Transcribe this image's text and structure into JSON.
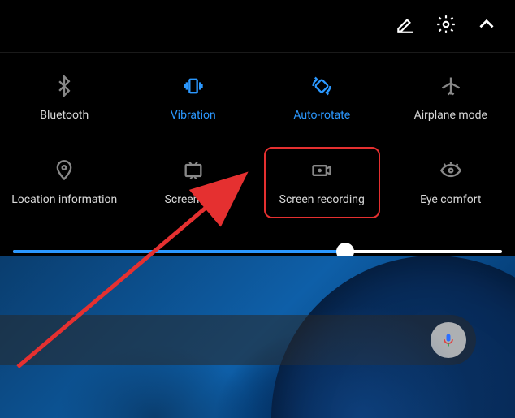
{
  "topbar": {
    "edit_icon": "edit-icon",
    "settings_icon": "gear-icon",
    "collapse_icon": "chevron-up-icon"
  },
  "tiles": [
    {
      "id": "bluetooth",
      "label": "Bluetooth",
      "active": false
    },
    {
      "id": "vibration",
      "label": "Vibration",
      "active": true
    },
    {
      "id": "autorotate",
      "label": "Auto-rotate",
      "active": true
    },
    {
      "id": "airplane",
      "label": "Airplane mode",
      "active": false
    },
    {
      "id": "location",
      "label": "Location information",
      "active": false
    },
    {
      "id": "screenshot",
      "label": "Screenshot",
      "active": false
    },
    {
      "id": "screenrec",
      "label": "Screen recording",
      "active": false
    },
    {
      "id": "eyecomfort",
      "label": "Eye comfort",
      "active": false
    }
  ],
  "brightness": {
    "percent": 68
  },
  "highlight_tile_id": "screenrec",
  "colors": {
    "accent": "#2b98ff",
    "highlight": "#e53030",
    "inactive": "#888"
  }
}
